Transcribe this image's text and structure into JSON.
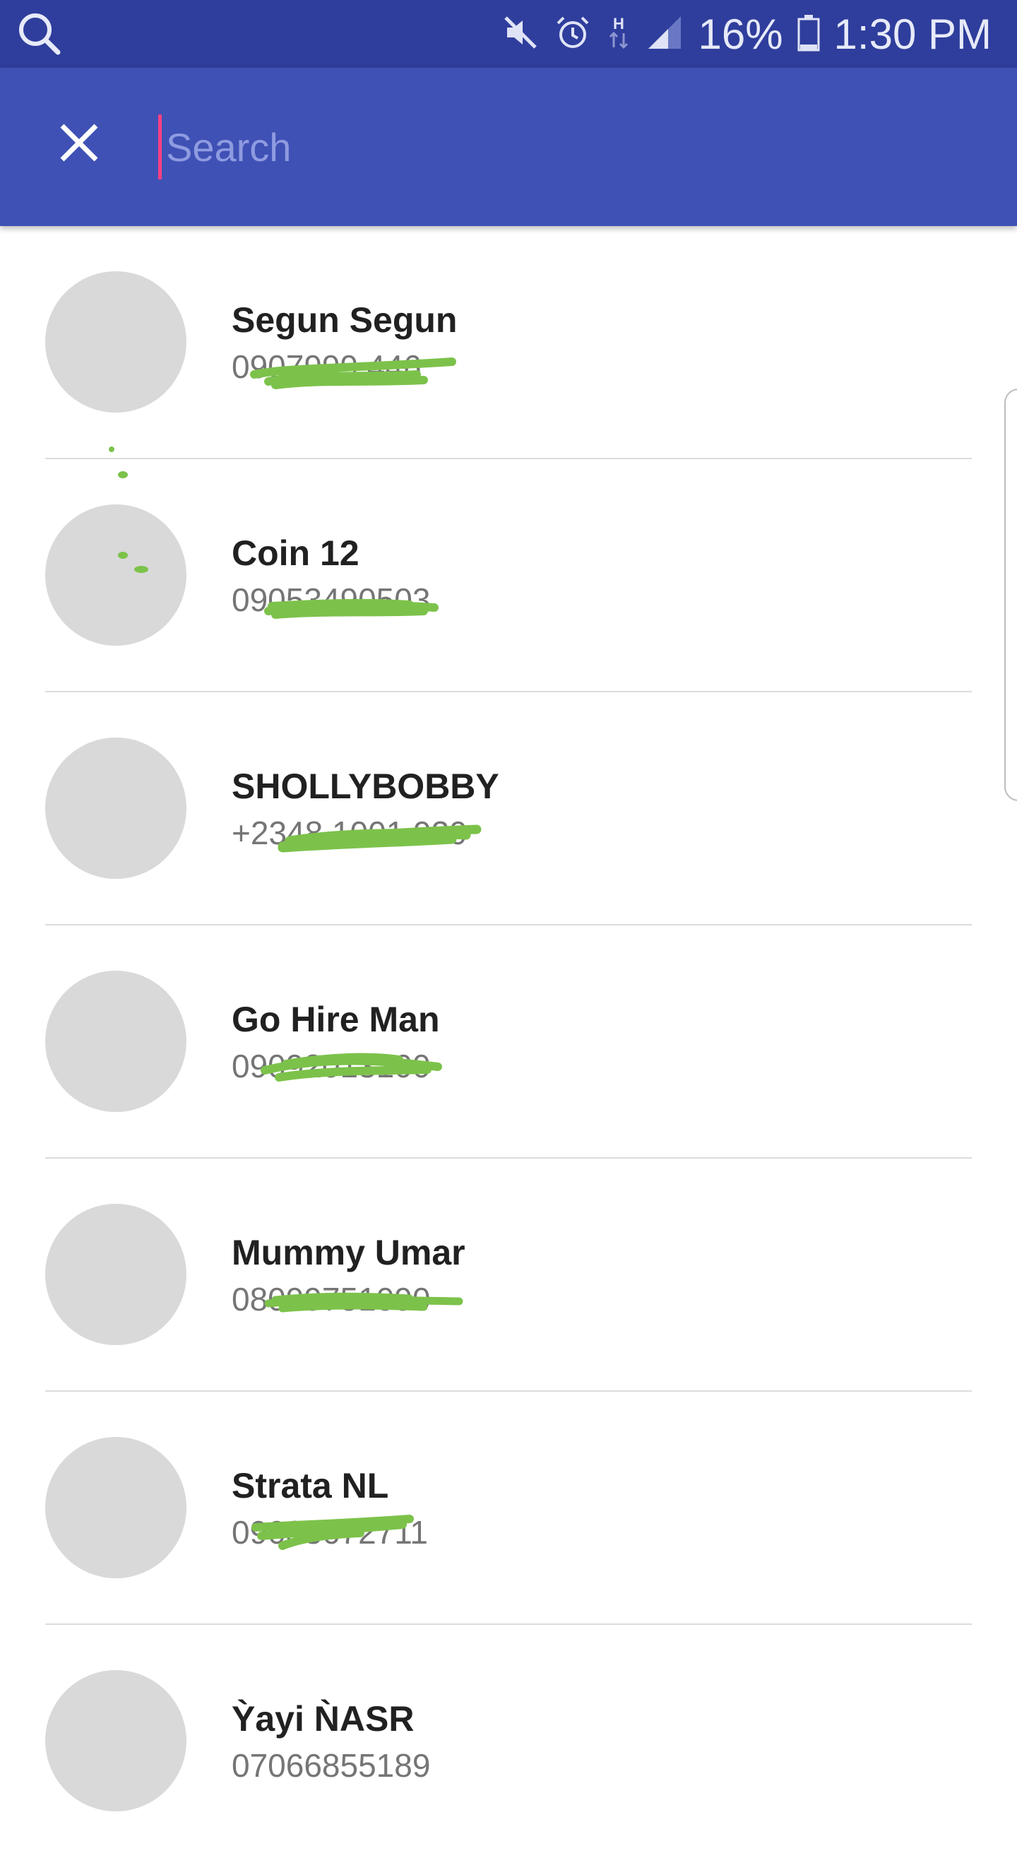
{
  "status_bar": {
    "icons": [
      "search-icon",
      "mute-icon",
      "alarm-icon",
      "h-data-icon",
      "signal-icon",
      "battery-icon"
    ],
    "battery": "16%",
    "time": "1:30 PM"
  },
  "search": {
    "placeholder": "Search",
    "value": ""
  },
  "contacts": [
    {
      "name": "Segun Segun",
      "phone": "0907999 446"
    },
    {
      "name": "Coin 12",
      "phone": "09053490503"
    },
    {
      "name": "SHOLLYBOBBY",
      "phone": "+2348 1001 929"
    },
    {
      "name": "Go Hire Man",
      "phone": "09092013100"
    },
    {
      "name": "Mummy Umar",
      "phone": "08099751090"
    },
    {
      "name": "Strata NL",
      "phone": "09033672711"
    },
    {
      "name": "Ỳayi ǸASR",
      "phone": "07066855189"
    }
  ],
  "colors": {
    "status_bar": "#2f3e9c",
    "app_bar": "#3f51b5",
    "cursor": "#ff4081",
    "avatar": "#d9d9d9",
    "redaction": "#7cc24a"
  }
}
